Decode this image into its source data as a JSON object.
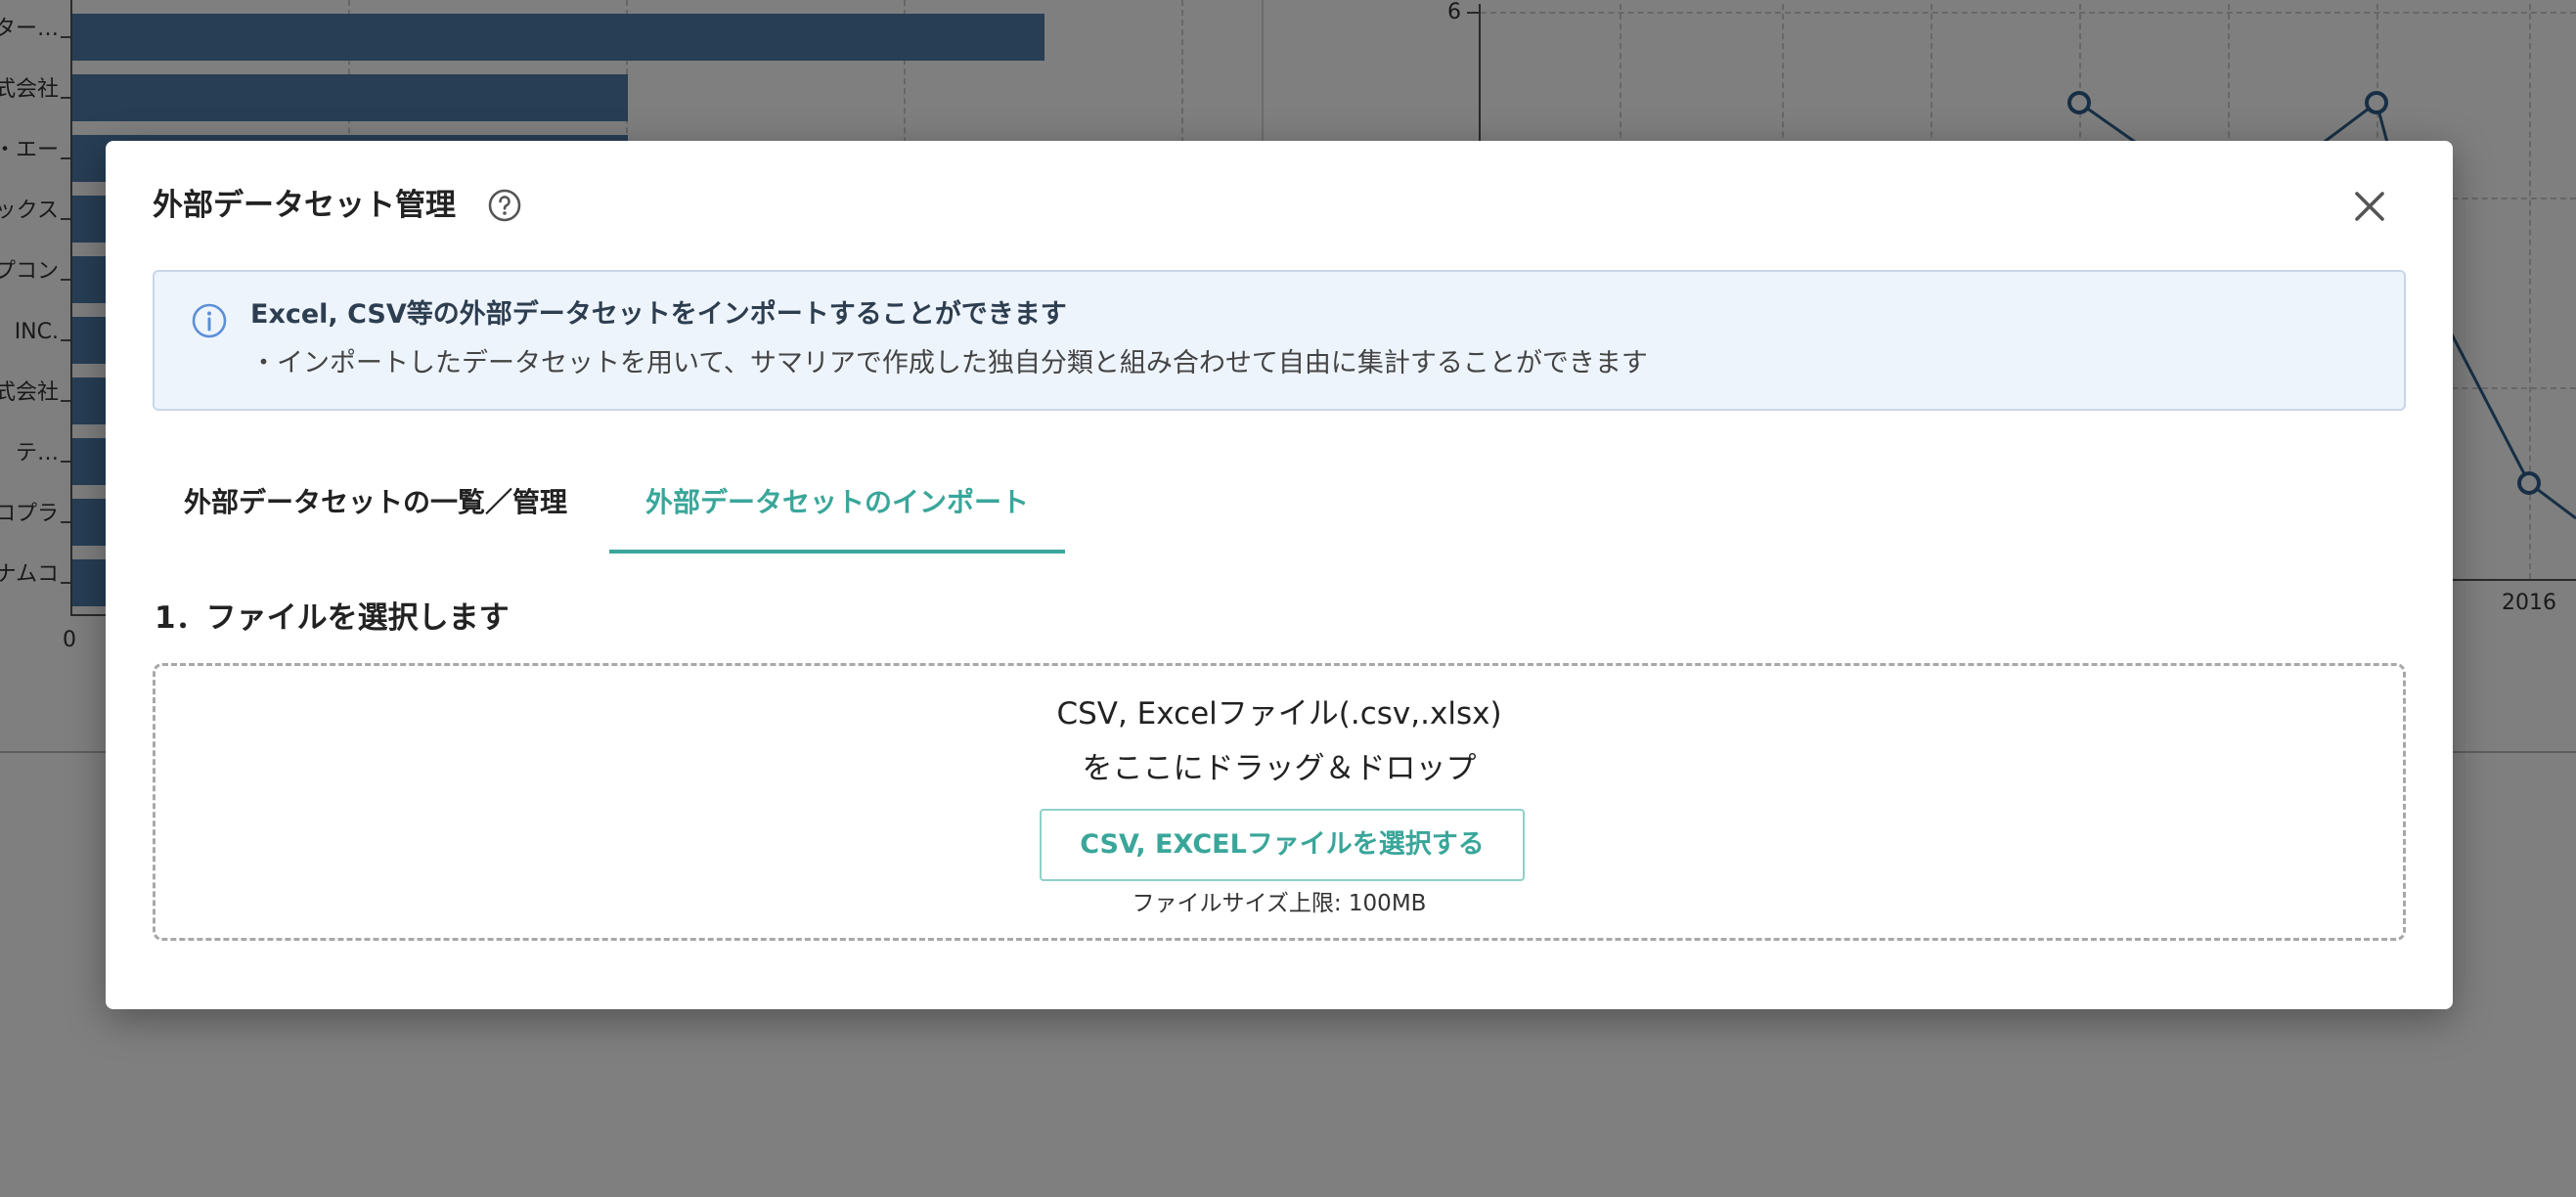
{
  "background": {
    "bar_labels": [
      "ター…",
      "式会社",
      "・エー",
      "ックス",
      "プコン",
      "INC.",
      "式会社",
      "テ…",
      "ロプラ",
      "ナムコ"
    ],
    "bar_axis_zero": "0",
    "line_y_label": "6",
    "line_x_label": "2016",
    "bar_color": "#4f7cab",
    "line_color": "#2e5f8a"
  },
  "modal": {
    "title": "外部データセット管理",
    "help_icon": "question-circle-icon",
    "close_icon": "close-icon",
    "info": {
      "icon": "info-circle-icon",
      "heading": "Excel, CSV等の外部データセットをインポートすることができます",
      "body": "・インポートしたデータセットを用いて、サマリアで作成した独自分類と組み合わせて自由に集計することができます"
    },
    "tabs": [
      {
        "label": "外部データセットの一覧／管理",
        "active": false
      },
      {
        "label": "外部データセットのインポート",
        "active": true
      }
    ],
    "step_title": "1．ファイルを選択します",
    "dropzone": {
      "line1": "CSV, Excelファイル(.csv,.xlsx)",
      "line2": "をここにドラッグ＆ドロップ",
      "button_label": "CSV, EXCELファイルを選択する",
      "size_limit": "ファイルサイズ上限: 100MB"
    },
    "accent_color": "#3aa69a"
  }
}
